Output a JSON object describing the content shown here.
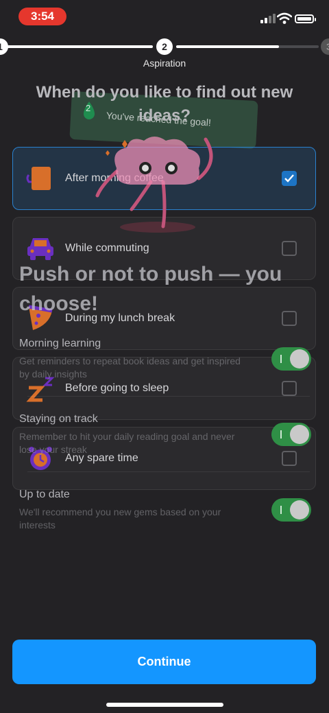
{
  "status_bar": {
    "time": "3:54"
  },
  "stepper": {
    "steps": [
      {
        "number": "1"
      },
      {
        "number": "2",
        "label": "Aspiration"
      },
      {
        "number": "3"
      }
    ],
    "current_label": "Aspiration"
  },
  "question": "When do you like to find out new ideas?",
  "goal_card": {
    "badge": "2",
    "text": "You've reached the goal!"
  },
  "options": [
    {
      "label": "After morning coffee",
      "icon": "coffee-cup-icon",
      "checked": true
    },
    {
      "label": "While commuting",
      "icon": "car-icon",
      "checked": false
    },
    {
      "label": "During my lunch break",
      "icon": "pizza-icon",
      "checked": false
    },
    {
      "label": "Before going to sleep",
      "icon": "sleep-zz-icon",
      "checked": false
    },
    {
      "label": "Any spare time",
      "icon": "alarm-clock-icon",
      "checked": false
    }
  ],
  "ghost_screen": {
    "title": "Push or not to push — you choose!",
    "settings": [
      {
        "title": "Morning learning",
        "desc": "Get reminders to repeat book ideas and get inspired by daily insights",
        "enabled": true
      },
      {
        "title": "Staying on track",
        "desc": "Remember to hit your daily reading goal and never lose your streak",
        "enabled": true
      },
      {
        "title": "Up to date",
        "desc": "We'll recommend you new gems based on your interests",
        "enabled": true
      }
    ]
  },
  "continue_label": "Continue",
  "colors": {
    "accent": "#1496ff",
    "selected_border": "#2a82d0",
    "toggle_on": "#2f8f46",
    "time_pill": "#e5372d"
  }
}
